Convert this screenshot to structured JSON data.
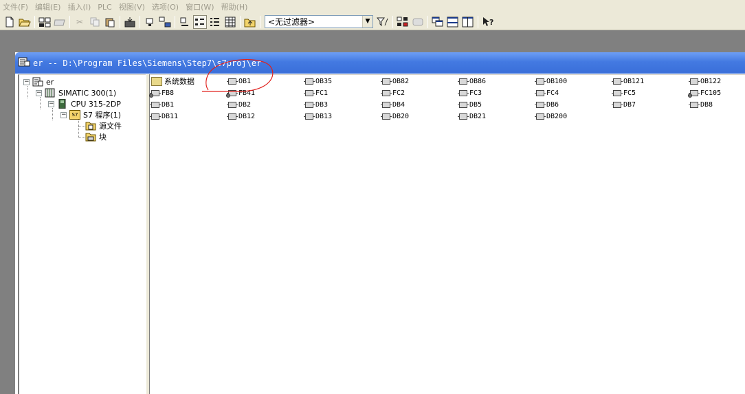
{
  "menu": [
    "文件(F)",
    "编辑(E)",
    "插入(I)",
    "PLC",
    "视图(V)",
    "选项(O)",
    "窗口(W)",
    "帮助(H)"
  ],
  "toolbar": {
    "filter_value": "<无过滤器>"
  },
  "window": {
    "title": "er -- D:\\Program Files\\Siemens\\Step7\\s7proj\\er"
  },
  "tree": {
    "root": "er",
    "station": "SIMATIC 300(1)",
    "cpu": "CPU 315-2DP",
    "program_badge": "S7",
    "program": "S7 程序(1)",
    "sources": "源文件",
    "blocks": "块"
  },
  "blocks": {
    "system_data": "系统数据",
    "row1": [
      "OB1",
      "OB35",
      "OB82",
      "OB86",
      "OB100",
      "OB121",
      "OB122"
    ],
    "row2": [
      "FB8",
      "FB41",
      "FC1",
      "FC2",
      "FC3",
      "FC4",
      "FC5",
      "FC105"
    ],
    "row3": [
      "DB1",
      "DB2",
      "DB3",
      "DB4",
      "DB5",
      "DB6",
      "DB7",
      "DB8"
    ],
    "row4": [
      "DB11",
      "DB12",
      "DB13",
      "DB20",
      "DB21",
      "DB200"
    ]
  },
  "colors": {
    "title_bar": "#4379e1",
    "annotation": "#e0201c"
  }
}
